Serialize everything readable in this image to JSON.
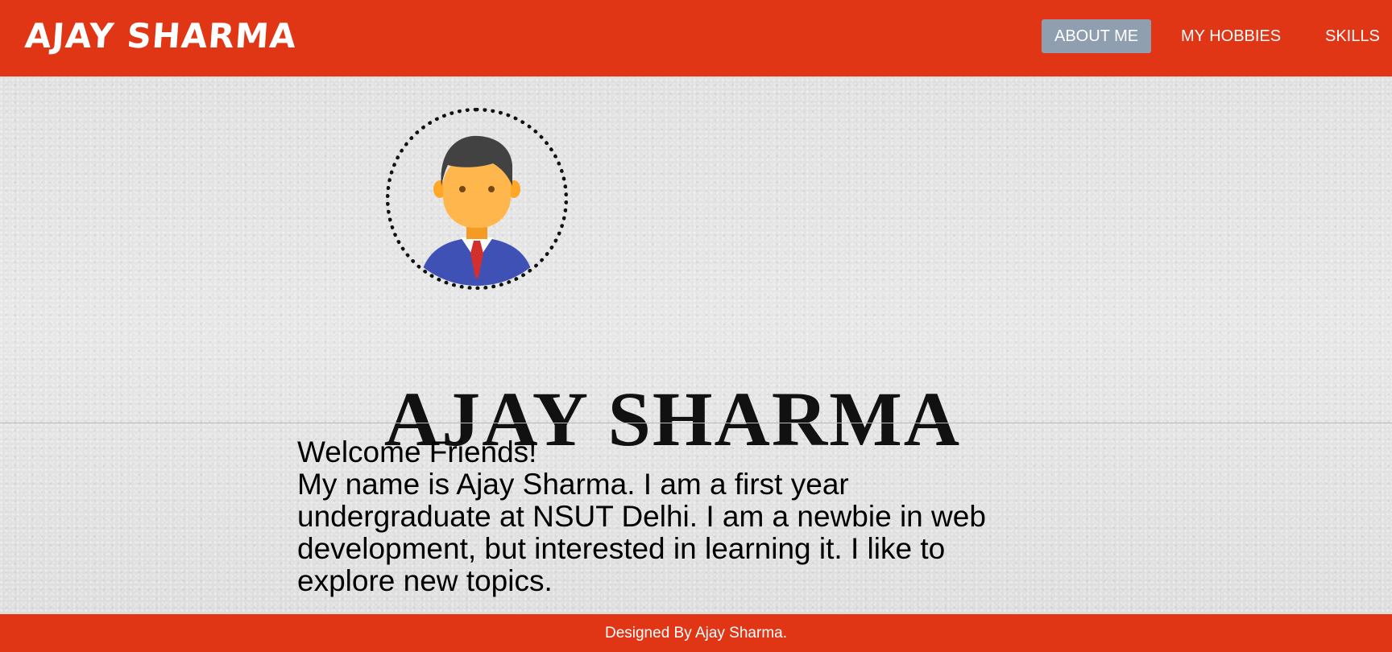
{
  "navbar": {
    "brand": "AJAY SHARMA",
    "links": [
      {
        "label": "ABOUT ME",
        "active": true
      },
      {
        "label": "MY HOBBIES",
        "active": false
      },
      {
        "label": "SKILLS",
        "active": false
      }
    ],
    "background_color": "#e03616",
    "active_link_color": "#8f9faf"
  },
  "hero": {
    "avatar_icon": "businessman-avatar-icon",
    "name": "AJAY SHARMA"
  },
  "about": {
    "greeting": "Welcome Friends!",
    "bio": "My name is Ajay Sharma. I am a first year undergraduate at NSUT Delhi. I am a newbie in web development, but interested in learning it. I like to explore new topics."
  },
  "footer": {
    "text": "Designed By Ajay Sharma."
  }
}
